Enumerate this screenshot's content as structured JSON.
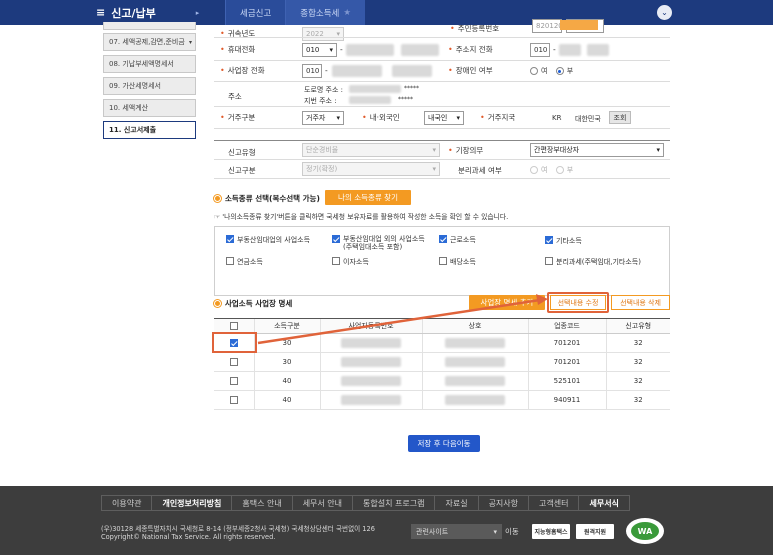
{
  "header": {
    "menu": "신고/납부",
    "crumb1": "세금신고",
    "crumb2": "종합소득세"
  },
  "sidebar": {
    "items": [
      "07. 세액공제,감면,준비금",
      "08. 기납부세액명세서",
      "09. 가산세명세서",
      "10. 세액계산",
      "11. 신고서제출"
    ]
  },
  "form": {
    "year_label": "귀속년도",
    "year_value": "2022",
    "bizno_label": "주민등록번호",
    "bizno_value": "820120",
    "mobile_label": "휴대전화",
    "mobile_prefix": "010",
    "addrphone_label": "주소지 전화",
    "addrphone_prefix": "010",
    "bizphone_label": "사업장 전화",
    "bizphone_prefix": "010",
    "disabled_label": "장애인 여부",
    "radio_yes": "여",
    "radio_no": "부",
    "address_label": "주소",
    "road_label": "도로명 주소 :",
    "lot_label": "지번 주소 :",
    "mask": "*****",
    "resident_label": "거주구분",
    "resident_value": "거주자",
    "nationality_label": "내·외국인",
    "nationality_value": "내국인",
    "country_label": "거주지국",
    "country_code": "KR",
    "country_name": "대한민국",
    "lookup_btn": "조회",
    "filing_type_label": "신고유형",
    "filing_type_value": "단순경비율",
    "bookkeeping_label": "기장의무",
    "bookkeeping_value": "간편장부대상자",
    "filing_kind_label": "신고구분",
    "filing_kind_value": "정기(확정)",
    "separate_label": "분리과세 여부",
    "sep_yes": "여",
    "sep_no": "부"
  },
  "income": {
    "section_title": "소득종류 선택(복수선택 가능)",
    "find_btn": "나의 소득종류 찾기",
    "note": "'나의소득종류 찾기'버튼을 클릭하면 국세청 보유자료를 활용하여 작성한 소득을 확인 할 수 있습니다.",
    "types": [
      {
        "label": "부동산임대업의 사업소득",
        "checked": true
      },
      {
        "label": "부동산임대업 외의 사업소득\n(주택임대소득 포함)",
        "checked": true
      },
      {
        "label": "근로소득",
        "checked": true
      },
      {
        "label": "기타소득",
        "checked": true
      },
      {
        "label": "연금소득",
        "checked": false
      },
      {
        "label": "이자소득",
        "checked": false
      },
      {
        "label": "배당소득",
        "checked": false
      },
      {
        "label": "분리과세(주택임대,기타소득)",
        "checked": false
      }
    ]
  },
  "biz": {
    "section_title": "사업소득 사업장 명세",
    "add_btn": "사업장 명세 추가",
    "edit_btn": "선택내용 수정",
    "delete_btn": "선택내용 삭제",
    "columns": [
      "",
      "소득구분",
      "사업자등록번호",
      "상호",
      "업종코드",
      "신고유형"
    ],
    "rows": [
      {
        "checked": true,
        "type": "30",
        "code": "701201",
        "filing": "32"
      },
      {
        "checked": false,
        "type": "30",
        "code": "701201",
        "filing": "32"
      },
      {
        "checked": false,
        "type": "40",
        "code": "525101",
        "filing": "32"
      },
      {
        "checked": false,
        "type": "40",
        "code": "940911",
        "filing": "32"
      }
    ]
  },
  "save_btn": "저장 후 다음이동",
  "footer": {
    "links": [
      "이용약관",
      "개인정보처리방침",
      "홈택스 안내",
      "세무서 안내",
      "통합설치 프로그램",
      "자료실",
      "공지사항",
      "고객센터",
      "세무서식"
    ],
    "address": "(우)30128 세종특별자치시 국세청로 8-14 (정부세종2청사 국세청) 국세청상담센터 국번없이 126",
    "copyright": "Copyright© National Tax Service. All rights reserved.",
    "related": "관련사이트",
    "go": "이동",
    "logo1": "지능형홈택스",
    "logo2": "원격지원",
    "wa": "WA"
  },
  "colors": {
    "navy": "#1d3a7e",
    "orange": "#f39a22",
    "annotation": "#e0633a"
  }
}
